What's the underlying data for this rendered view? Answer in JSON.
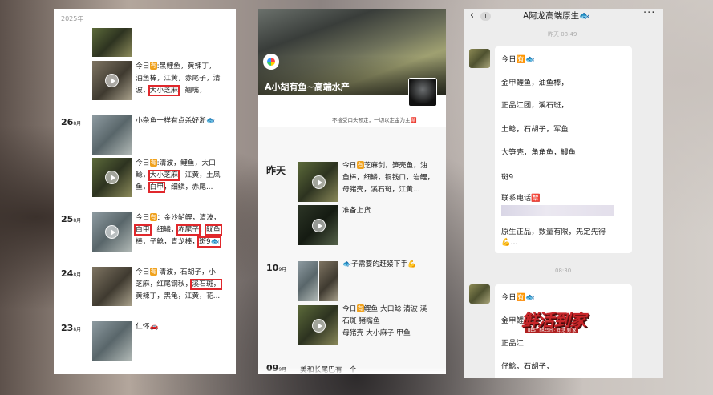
{
  "p1": {
    "year": "2025年",
    "days": [
      {
        "d": "26",
        "m": "8月"
      },
      {
        "d": "25",
        "m": "8月"
      },
      {
        "d": "24",
        "m": "8月"
      },
      {
        "d": "23",
        "m": "8月"
      }
    ],
    "posts": [
      {
        "a": "今日",
        "b": ":黑鲤鱼，黄辣丁，",
        "l2": "油鱼棒，江黄，赤尾子，清",
        "l3a": "波，",
        "l3b": "大小芝麻",
        "l3c": "，翘嘴，"
      },
      {
        "a": "小杂鱼一样有点杀好浙🐟"
      },
      {
        "a": "今日",
        "b": ":清波，鲤鱼，大口",
        "l2a": "鲶，",
        "l2b": "大小芝麻",
        "l2c": "，江黄，土凤",
        "l3a": "鱼，",
        "l3b": "白甲",
        "l3c": "，细鳞，赤尾..."
      },
      {
        "a": "今日",
        "b": "：金沙鲈鲤，清波，",
        "l2a": "白甲",
        "l2b": "，细鳞，",
        "l2c": "赤尾子",
        "l2d": "，",
        "l2e": "鱿鱼",
        "l3a": "棒，子鲶，青龙棒，",
        "l3b": "斑9🐟"
      },
      {
        "a": "今日",
        "b": " 清波，石胡子，小",
        "l2a": "芝麻，红尾钢秋，",
        "l2b": "溪石斑，",
        "l3": "黄辣丁，黑龟，江黄，花..."
      },
      {
        "a": "仁怀🚗"
      }
    ]
  },
  "p2": {
    "title": "A小胡有鱼~高端水产",
    "note": "不接受口头预定，一切以定金为主🈲",
    "days": [
      {
        "d": "昨天"
      },
      {
        "d": "10",
        "m": "9月"
      },
      {
        "d": "09",
        "m": "9月"
      }
    ],
    "posts": [
      {
        "a": "今日",
        "b": "芝麻剑，笋壳鱼，油",
        "l2": "鱼棒，细鳞，铜钱口，岩鲤，",
        "l3": "母猪壳，溪石斑，江黄..."
      },
      {
        "a": "准备上货"
      },
      {
        "a": "🐟子需要的赶紧下手💪"
      },
      {
        "a": "今日",
        "b": "鲤鱼 大口鲶 清波 溪",
        "l2": "石斑 猪嘴鱼",
        "l3": "母猪壳 大小麻子 甲鱼"
      },
      {
        "a": "美和长尾巴有一个"
      }
    ]
  },
  "p3": {
    "back": "‹",
    "badge": "1",
    "title": "A阿龙高端原生🐟",
    "more": "···",
    "t1": "昨天 08:49",
    "t2": "08:30",
    "msg1": [
      "今日🈶🐟",
      "金甲鲤鱼，油鱼棒，",
      "正品江团，溪石斑，",
      "土鲶，石胡子，军鱼",
      "大笋壳，角角鱼，鳗鱼",
      "斑9",
      "联系电话🈲",
      "原生正品，数量有限，先定先得",
      "💪..."
    ],
    "msg2": [
      "今日🈶🐟",
      "金甲鲤",
      "正品江",
      "仔鲶，石胡子，"
    ],
    "stamp": "鲜活到家",
    "stamp_sub": "BEST FRESH · 鲜 活 到 家"
  },
  "tag": "有"
}
